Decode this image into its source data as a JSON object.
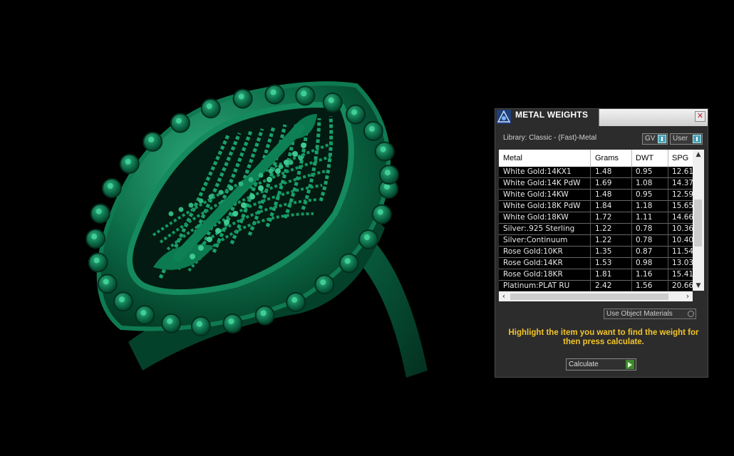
{
  "viewport": {
    "object": "green filigree ring 3D model",
    "accent_color": "#0a6b4a"
  },
  "panel": {
    "title": "METAL WEIGHTS",
    "close_label": "✕",
    "library_label": "Library: Classic - (Fast)-Metal",
    "toggle_gv": "GV",
    "toggle_user": "User",
    "columns": [
      "Metal",
      "Grams",
      "DWT",
      "SPG"
    ],
    "rows": [
      {
        "metal": "White Gold:14KX1",
        "grams": "1.48",
        "dwt": "0.95",
        "spg": "12.61"
      },
      {
        "metal": "White Gold:14K PdW",
        "grams": "1.69",
        "dwt": "1.08",
        "spg": "14.37"
      },
      {
        "metal": "White Gold:14KW",
        "grams": "1.48",
        "dwt": "0.95",
        "spg": "12.59"
      },
      {
        "metal": "White Gold:18K PdW",
        "grams": "1.84",
        "dwt": "1.18",
        "spg": "15.65"
      },
      {
        "metal": "White Gold:18KW",
        "grams": "1.72",
        "dwt": "1.11",
        "spg": "14.66"
      },
      {
        "metal": "Silver:.925 Sterling",
        "grams": "1.22",
        "dwt": "0.78",
        "spg": "10.36"
      },
      {
        "metal": "Silver:Continuum",
        "grams": "1.22",
        "dwt": "0.78",
        "spg": "10.40"
      },
      {
        "metal": "Rose Gold:10KR",
        "grams": "1.35",
        "dwt": "0.87",
        "spg": "11.54"
      },
      {
        "metal": "Rose Gold:14KR",
        "grams": "1.53",
        "dwt": "0.98",
        "spg": "13.03"
      },
      {
        "metal": "Rose Gold:18KR",
        "grams": "1.81",
        "dwt": "1.16",
        "spg": "15.41"
      },
      {
        "metal": "Platinum:PLAT RU",
        "grams": "2.42",
        "dwt": "1.56",
        "spg": "20.66"
      }
    ],
    "use_object_materials": "Use Object Materials",
    "instructions": "Highlight the item you want to find the weight for then press calculate.",
    "calculate_label": "Calculate",
    "instruction_color": "#f2c42a"
  }
}
